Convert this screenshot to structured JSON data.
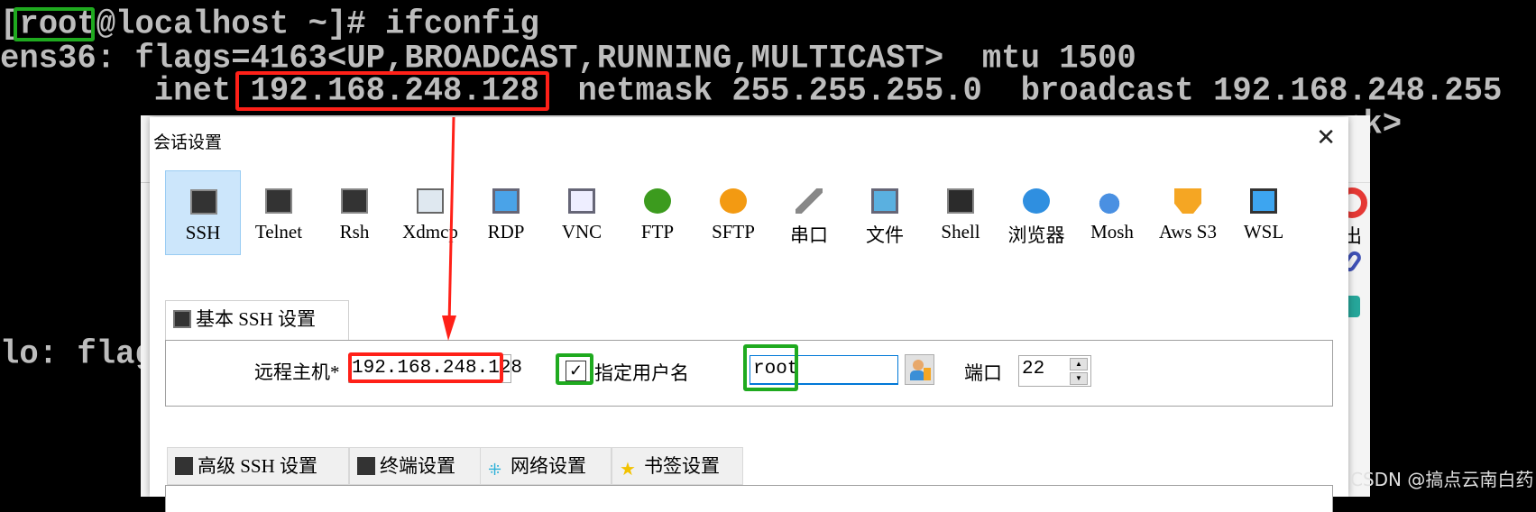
{
  "terminal": {
    "line1": "[root@localhost ~]# ifconfig",
    "line2": "ens36: flags=4163<UP,BROADCAST,RUNNING,MULTICAST>  mtu 1500",
    "line3": "        inet 192.168.248.128  netmask 255.255.255.0  broadcast 192.168.248.255",
    "line4_tail": "nk>",
    "line5": "lo: flag"
  },
  "dialog": {
    "title": "会话设置",
    "close_icon": "close-icon",
    "protocols": [
      {
        "label": "SSH",
        "icon": "key-icon",
        "selected": true
      },
      {
        "label": "Telnet",
        "icon": "gem-icon"
      },
      {
        "label": "Rsh",
        "icon": "gears-icon"
      },
      {
        "label": "Xdmcp",
        "icon": "x-monitor-icon"
      },
      {
        "label": "RDP",
        "icon": "windows-monitor-icon"
      },
      {
        "label": "VNC",
        "icon": "vnc-monitor-icon"
      },
      {
        "label": "FTP",
        "icon": "green-globe-icon"
      },
      {
        "label": "SFTP",
        "icon": "orange-globe-icon"
      },
      {
        "label": "串口",
        "icon": "plug-icon"
      },
      {
        "label": "文件",
        "icon": "globe-monitor-icon"
      },
      {
        "label": "Shell",
        "icon": "terminal-icon"
      },
      {
        "label": "浏览器",
        "icon": "globe-icon"
      },
      {
        "label": "Mosh",
        "icon": "satellite-dish-icon"
      },
      {
        "label": "Aws S3",
        "icon": "cubes-icon"
      },
      {
        "label": "WSL",
        "icon": "windows-icon"
      }
    ],
    "basic_tab": "基本 SSH 设置",
    "remote_host_label": "远程主机*",
    "remote_host_value": "192.168.248.128",
    "specify_user_label": "指定用户名",
    "specify_user_checked": true,
    "username_value": "root",
    "port_label": "端口",
    "port_value": "22",
    "lower_tabs": [
      "高级 SSH 设置",
      "终端设置",
      "网络设置",
      "书签设置"
    ]
  },
  "side_strip": {
    "label": "出"
  },
  "watermark": "CSDN @搞点云南白药",
  "colors": {
    "highlight_red": "#ff2018",
    "highlight_green": "#1faa1f",
    "selected_bg": "#cce6fb",
    "terminal_text": "#bdbdbd"
  }
}
